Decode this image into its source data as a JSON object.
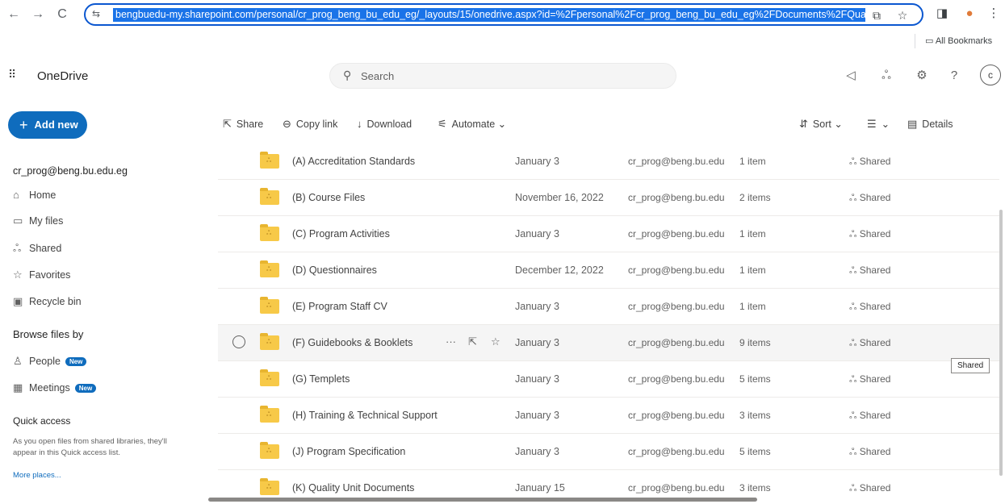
{
  "browser": {
    "back": "←",
    "forward": "→",
    "reload": "C",
    "site_info": "⇆",
    "url": "bengbuedu-my.sharepoint.com/personal/cr_prog_beng_bu_edu_eg/_layouts/15/onedrive.aspx?id=%2Fpersonal%2Fcr_prog_beng_bu_edu_eg%2FDocuments%2FQua",
    "bookmarks_label": "All Bookmarks"
  },
  "header": {
    "app_name": "OneDrive",
    "search_placeholder": "Search",
    "avatar_initial": "c"
  },
  "sidebar": {
    "add_new": "Add new",
    "account": "cr_prog@beng.bu.edu.eg",
    "items": [
      {
        "label": "Home",
        "icon": "home-icon"
      },
      {
        "label": "My files",
        "icon": "folder-icon"
      },
      {
        "label": "Shared",
        "icon": "people-icon"
      },
      {
        "label": "Favorites",
        "icon": "star-icon"
      },
      {
        "label": "Recycle bin",
        "icon": "trash-icon"
      }
    ],
    "browse_title": "Browse files by",
    "browse_items": [
      {
        "label": "People",
        "badge": "New",
        "icon": "person-icon"
      },
      {
        "label": "Meetings",
        "badge": "New",
        "icon": "calendar-icon"
      }
    ],
    "quick_access_title": "Quick access",
    "quick_access_text": "As you open files from shared libraries, they'll appear in this Quick access list.",
    "more_places": "More places..."
  },
  "commands": {
    "share": "Share",
    "copy_link": "Copy link",
    "download": "Download",
    "automate": "Automate",
    "sort": "Sort",
    "details": "Details"
  },
  "files": [
    {
      "name": "(A) Accreditation Standards",
      "date": "January 3",
      "owner": "cr_prog@beng.bu.edu",
      "count": "1 item",
      "sharing": "Shared"
    },
    {
      "name": "(B) Course Files",
      "date": "November 16, 2022",
      "owner": "cr_prog@beng.bu.edu",
      "count": "2 items",
      "sharing": "Shared"
    },
    {
      "name": "(C) Program Activities",
      "date": "January 3",
      "owner": "cr_prog@beng.bu.edu",
      "count": "1 item",
      "sharing": "Shared"
    },
    {
      "name": "(D) Questionnaires",
      "date": "December 12, 2022",
      "owner": "cr_prog@beng.bu.edu",
      "count": "1 item",
      "sharing": "Shared"
    },
    {
      "name": "(E) Program Staff CV",
      "date": "January 3",
      "owner": "cr_prog@beng.bu.edu",
      "count": "1 item",
      "sharing": "Shared"
    },
    {
      "name": "(F) Guidebooks & Booklets",
      "date": "January 3",
      "owner": "cr_prog@beng.bu.edu",
      "count": "9 items",
      "sharing": "Shared"
    },
    {
      "name": "(G) Templets",
      "date": "January 3",
      "owner": "cr_prog@beng.bu.edu",
      "count": "5 items",
      "sharing": "Shared"
    },
    {
      "name": "(H) Training & Technical Support",
      "date": "January 3",
      "owner": "cr_prog@beng.bu.edu",
      "count": "3 items",
      "sharing": "Shared"
    },
    {
      "name": "(J) Program Specification",
      "date": "January 3",
      "owner": "cr_prog@beng.bu.edu",
      "count": "5 items",
      "sharing": "Shared"
    },
    {
      "name": "(K) Quality Unit Documents",
      "date": "January 15",
      "owner": "cr_prog@beng.bu.edu",
      "count": "3 items",
      "sharing": "Shared"
    }
  ],
  "tooltip": "Shared",
  "colors": {
    "accent": "#0f6cbd",
    "folder": "#f7c948",
    "url_highlight": "#1a73e8"
  }
}
